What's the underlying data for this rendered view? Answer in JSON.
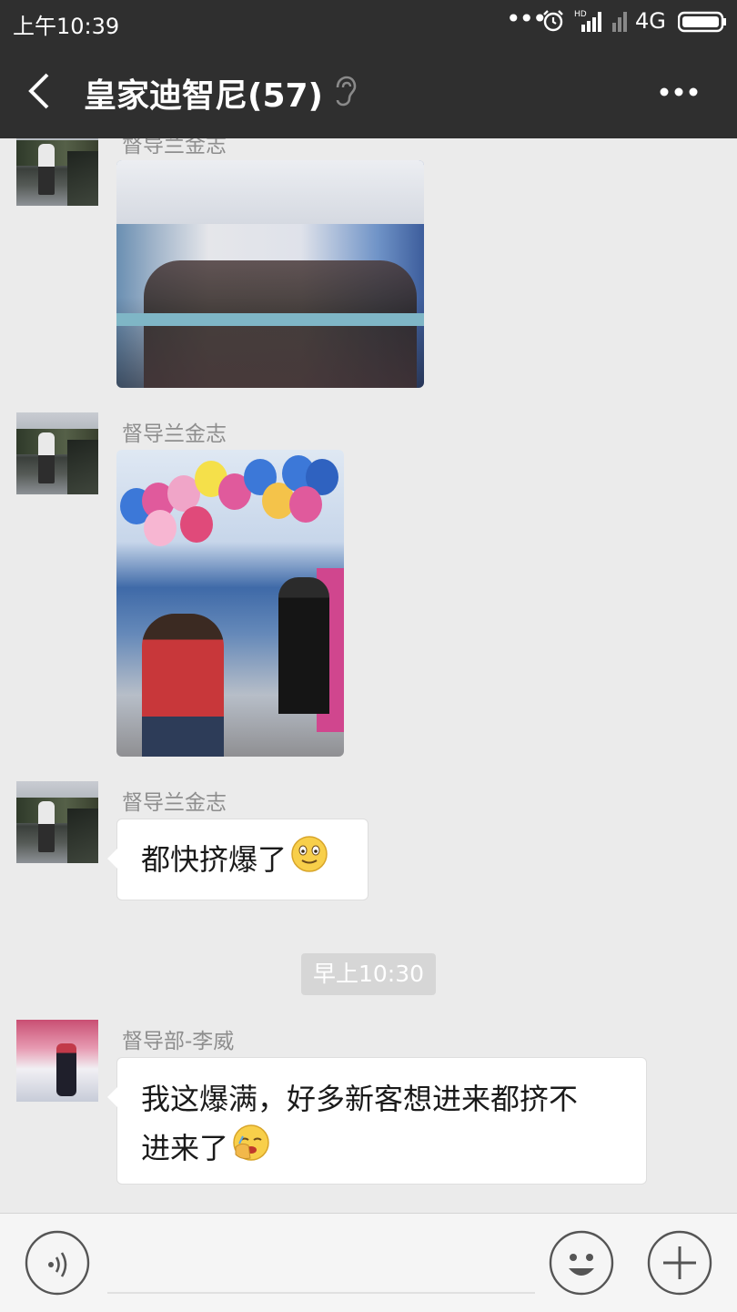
{
  "status_bar": {
    "time": "上午10:39",
    "hd_label": "HD",
    "network": "4G"
  },
  "header": {
    "title": "皇家迪智尼(57)",
    "back_icon": "chevron-left-icon",
    "mute_icon": "ear-icon",
    "more_icon": "more-icon"
  },
  "messages": [
    {
      "sender": "督导兰金志",
      "type": "image",
      "image": "store-crowd-photo"
    },
    {
      "sender": "督导兰金志",
      "type": "image",
      "image": "balloon-store-photo"
    },
    {
      "sender": "督导兰金志",
      "type": "text",
      "text": "都快挤爆了",
      "emoji": "smile-emoji"
    },
    {
      "sender": "督导部-李威",
      "type": "text",
      "lines": [
        "我这爆满，好多新客想进来都挤不",
        "进来了"
      ],
      "emoji": "facepalm-emoji"
    }
  ],
  "timestamp": "早上10:30",
  "input_bar": {
    "voice_icon": "voice-icon",
    "emoji_icon": "emoji-icon",
    "plus_icon": "plus-icon"
  },
  "colors": {
    "header_bg": "#2f2f2f",
    "chat_bg": "#ebebeb",
    "bubble_bg": "#ffffff",
    "sender_text": "#8e8e8e"
  }
}
